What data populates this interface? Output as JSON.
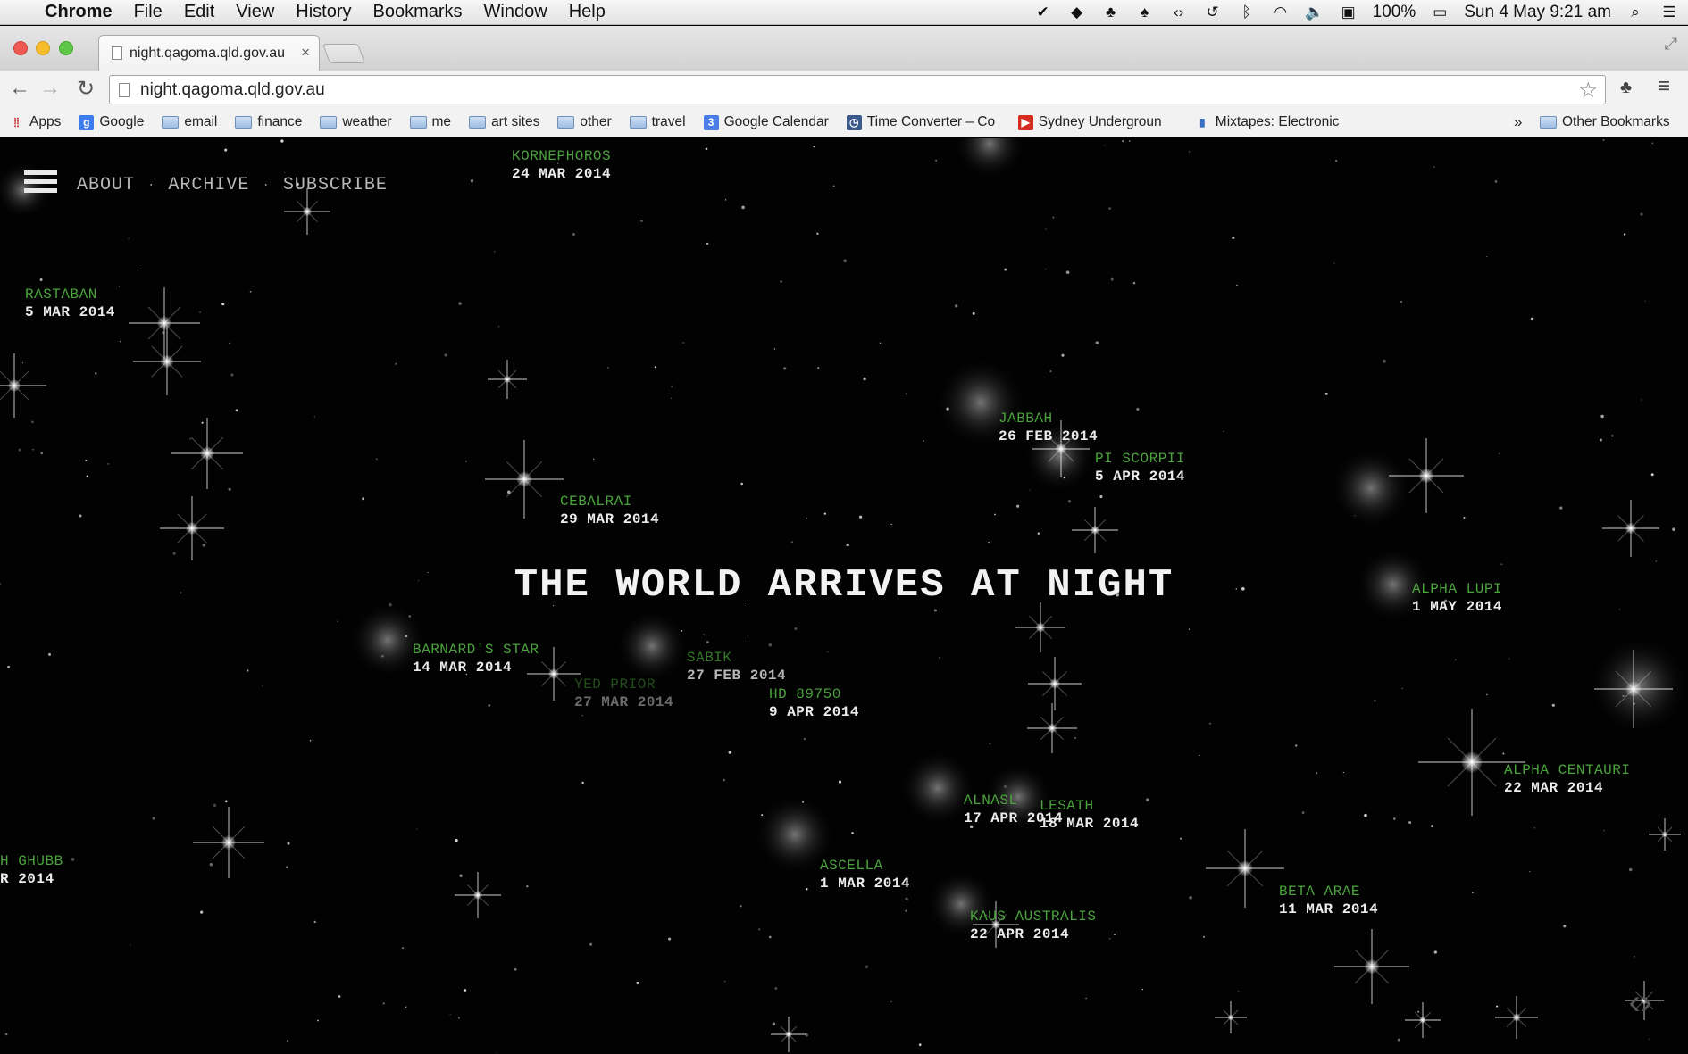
{
  "menubar": {
    "app": "Chrome",
    "items": [
      "File",
      "Edit",
      "View",
      "History",
      "Bookmarks",
      "Window",
      "Help"
    ],
    "battery": "100%",
    "clock": "Sun 4 May  9:21 am"
  },
  "tab": {
    "title": "night.qagoma.qld.gov.au"
  },
  "omnibox": {
    "url": "night.qagoma.qld.gov.au"
  },
  "bookmarks": {
    "items": [
      {
        "label": "Apps",
        "icon": "apps-icon"
      },
      {
        "label": "Google",
        "icon": "google-icon"
      },
      {
        "label": "email",
        "icon": "folder-icon"
      },
      {
        "label": "finance",
        "icon": "folder-icon"
      },
      {
        "label": "weather",
        "icon": "folder-icon"
      },
      {
        "label": "me",
        "icon": "folder-icon"
      },
      {
        "label": "art sites",
        "icon": "folder-icon"
      },
      {
        "label": "other",
        "icon": "folder-icon"
      },
      {
        "label": "travel",
        "icon": "folder-icon"
      },
      {
        "label": "Google Calendar",
        "icon": "calendar-icon"
      },
      {
        "label": "Time Converter – Co",
        "icon": "clock-site-icon"
      },
      {
        "label": "Sydney Undergroun",
        "icon": "youtube-icon"
      },
      {
        "label": "Mixtapes: Electronic",
        "icon": "chart-site-icon"
      }
    ],
    "overflow": "»",
    "other": "Other Bookmarks"
  },
  "site": {
    "nav": [
      "ABOUT",
      "ARCHIVE",
      "SUBSCRIBE"
    ],
    "headline": "THE WORLD ARRIVES AT NIGHT",
    "stars": [
      {
        "name": "KORNEPHOROS",
        "date": "24 MAR 2014"
      },
      {
        "name": "RASTABAN",
        "date": "5 MAR 2014"
      },
      {
        "name": "JABBAH",
        "date": "26 FEB 2014"
      },
      {
        "name": "PI SCORPII",
        "date": "5 APR 2014"
      },
      {
        "name": "CEBALRAI",
        "date": "29 MAR 2014"
      },
      {
        "name": "ALPHA LUPI",
        "date": "1 MAY 2014"
      },
      {
        "name": "BARNARD'S STAR",
        "date": "14 MAR 2014"
      },
      {
        "name": "SABIK",
        "date": "27 FEB 2014"
      },
      {
        "name": "YED PRIOR",
        "date": "27 MAR 2014"
      },
      {
        "name": "HD 89750",
        "date": "9 APR 2014"
      },
      {
        "name": "ALPHA CENTAURI",
        "date": "22 MAR 2014"
      },
      {
        "name": "ALNASL",
        "date": "17 APR 2014"
      },
      {
        "name": "LESATH",
        "date": "18 MAR 2014"
      },
      {
        "name": "ASCELLA",
        "date": "1 MAR 2014"
      },
      {
        "name": "BETA ARAE",
        "date": "11 MAR 2014"
      },
      {
        "name": "KAUS AUSTRALIS",
        "date": "22 APR 2014"
      },
      {
        "name": "H GHUBB",
        "date": "R 2014"
      }
    ]
  }
}
